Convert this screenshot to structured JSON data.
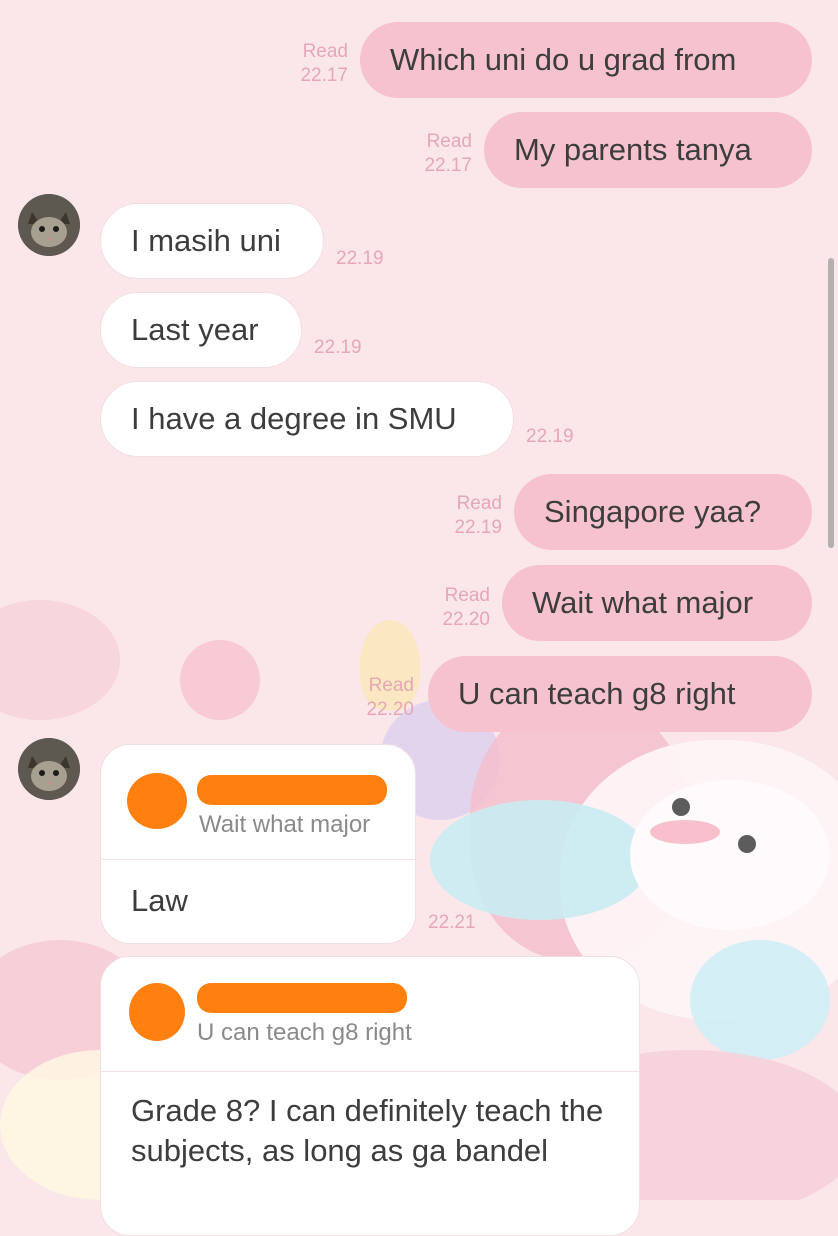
{
  "messages": [
    {
      "text": "Which uni do u grad from",
      "status": "Read",
      "time": "22.17"
    },
    {
      "text": "My parents tanya",
      "status": "Read",
      "time": "22.17"
    },
    {
      "text": "I masih uni",
      "time": "22.19"
    },
    {
      "text": "Last year",
      "time": "22.19"
    },
    {
      "text": "I have a degree in SMU",
      "time": "22.19"
    },
    {
      "text": "Singapore yaa?",
      "status": "Read",
      "time": "22.19"
    },
    {
      "text": "Wait what major",
      "status": "Read",
      "time": "22.20"
    },
    {
      "text": "U can teach g8 right",
      "status": "Read",
      "time": "22.20"
    },
    {
      "quote": "Wait what major",
      "text": "Law",
      "time": "22.21"
    },
    {
      "quote": "U can teach g8 right",
      "text": "Grade 8? I can definitely teach the subjects, as long as ga bandel"
    }
  ],
  "colors": {
    "outgoing_bubble": "#f5c2cd",
    "incoming_bubble": "#ffffff",
    "timestamp": "#e6a8b6",
    "redaction": "#ff7f0f"
  },
  "icons": {
    "avatar": "cat-avatar-icon"
  }
}
